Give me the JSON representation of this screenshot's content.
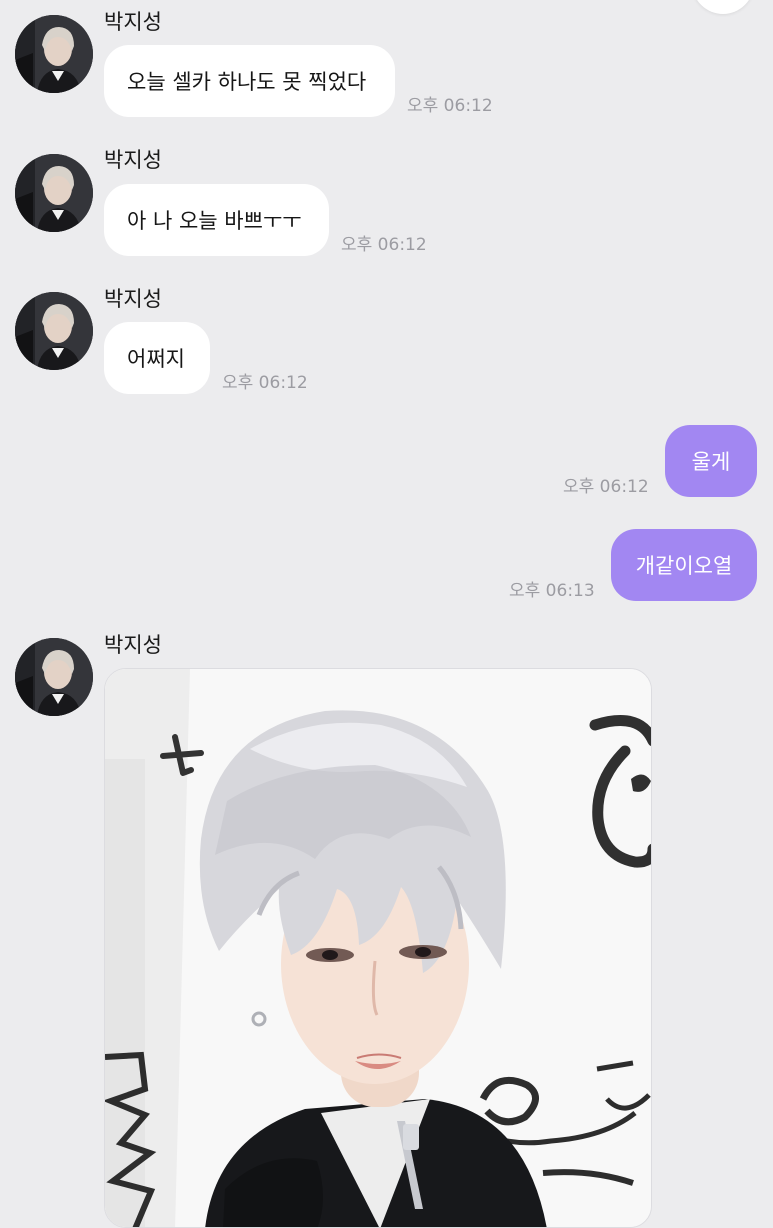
{
  "messages": [
    {
      "sender": "박지성",
      "text": "오늘 셀카 하나도 못 찍었다",
      "time": "오후 06:12"
    },
    {
      "sender": "박지성",
      "text": "아 나 오늘 바쁘ㅜㅜ",
      "time": "오후 06:12"
    },
    {
      "sender": "박지성",
      "text": "어쩌지",
      "time": "오후 06:12"
    },
    {
      "text": "울게",
      "time": "오후 06:12"
    },
    {
      "text": "개같이오열",
      "time": "오후 06:13"
    },
    {
      "sender": "박지성"
    }
  ],
  "colors": {
    "background": "#ececee",
    "incoming_bubble": "#ffffff",
    "outgoing_bubble": "#a287f2",
    "timestamp": "#9c9ca2"
  }
}
